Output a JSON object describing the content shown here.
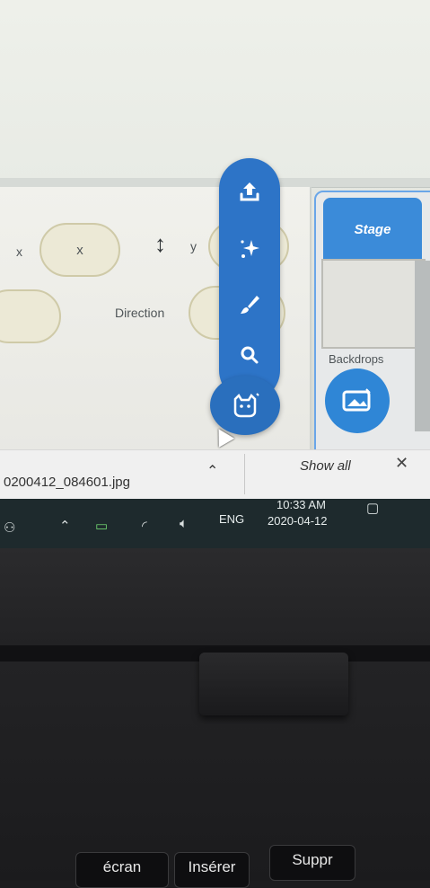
{
  "sprite_info": {
    "x_axis_label": "x",
    "x_value": "x",
    "y_axis_label": "y",
    "direction_label": "Direction"
  },
  "stage": {
    "title": "Stage",
    "backdrops_label": "Backdrops"
  },
  "flyout_menu": {
    "icons": [
      "upload-icon",
      "surprise-sparkle-icon",
      "paint-brush-icon",
      "search-icon",
      "choose-sprite-cat-icon"
    ]
  },
  "download_bar": {
    "file_name": "0200412_084601.jpg",
    "show_all_label": "Show all",
    "close_glyph": "✕"
  },
  "taskbar": {
    "language": "ENG",
    "time": "10:33 AM",
    "date": "2020-04-12"
  },
  "keyboard": {
    "keys": [
      "écran",
      "Insérer",
      "Suppr"
    ]
  },
  "colors": {
    "scratch_blue": "#2d74c7",
    "stage_header_blue": "#3b8bd9",
    "taskbar": "#1e2a2d",
    "laptop_body": "#1c1c1e"
  }
}
